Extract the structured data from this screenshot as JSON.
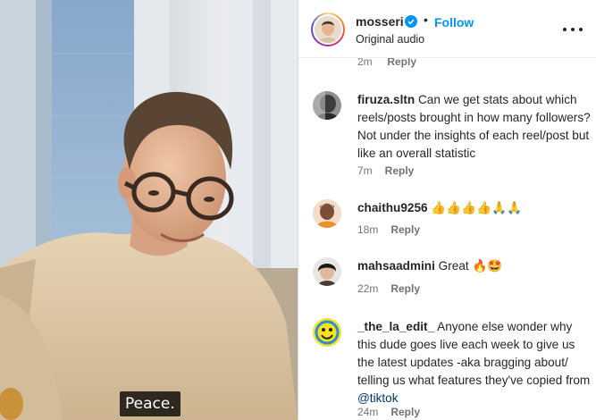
{
  "video": {
    "caption": "Peace."
  },
  "header": {
    "username": "mosseri",
    "separator": "•",
    "follow_label": "Follow",
    "audio_label": "Original audio"
  },
  "top_partial": {
    "time": "2m",
    "reply": "Reply"
  },
  "comments": [
    {
      "user": "firuza.sltn",
      "text": "Can we get stats about which reels/posts brought in how many followers? Not under the insights of each reel/post but like an overall statistic",
      "time": "7m",
      "reply": "Reply"
    },
    {
      "user": "chaithu9256",
      "text": "👍👍👍👍🙏🙏",
      "time": "18m",
      "reply": "Reply"
    },
    {
      "user": "mahsaadmini",
      "text": "Great 🔥🤩",
      "time": "22m",
      "reply": "Reply"
    },
    {
      "user": "_the_la_edit_",
      "text": "Anyone else wonder why this dude goes live each week to give us the latest updates -aka bragging about/ telling us what features they've copied from ",
      "mention": "@tiktok",
      "time": "24m",
      "reply": "Reply"
    }
  ],
  "colors": {
    "accent": "#0095f6",
    "text": "#262626",
    "secondary": "#737373",
    "mention": "#00376b"
  }
}
